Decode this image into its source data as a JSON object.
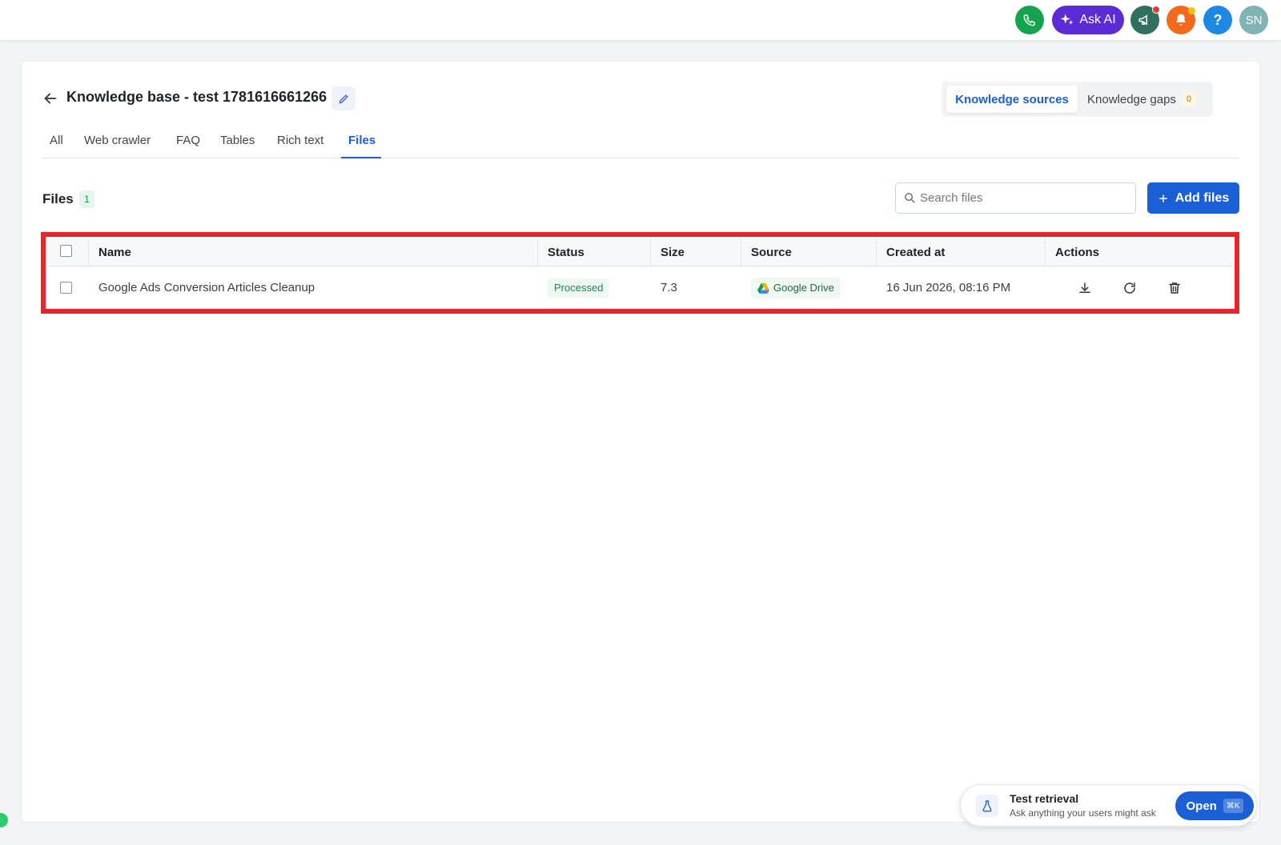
{
  "topbar": {
    "ask_ai_label": "Ask AI",
    "help_label": "?",
    "avatar_initials": "SN"
  },
  "header": {
    "title": "Knowledge base - test 1781616661266"
  },
  "switcher": {
    "sources_label": "Knowledge sources",
    "gaps_label": "Knowledge gaps",
    "gaps_count": "0"
  },
  "tabs": [
    {
      "label": "All"
    },
    {
      "label": "Web crawler"
    },
    {
      "label": "FAQ"
    },
    {
      "label": "Tables"
    },
    {
      "label": "Rich text"
    },
    {
      "label": "Files"
    }
  ],
  "active_tab": "Files",
  "files": {
    "title": "Files",
    "count": "1",
    "search_placeholder": "Search files",
    "add_button": "Add files"
  },
  "table": {
    "columns": [
      "Name",
      "Status",
      "Size",
      "Source",
      "Created at",
      "Actions"
    ],
    "rows": [
      {
        "name": "Google Ads Conversion Articles Cleanup",
        "status": "Processed",
        "size": "7.3",
        "source": "Google Drive",
        "created_at": "16 Jun 2026, 08:16 PM"
      }
    ]
  },
  "test_retrieval": {
    "title": "Test retrieval",
    "subtitle": "Ask anything your users might ask",
    "open_label": "Open",
    "shortcut": "⌘K"
  },
  "colors": {
    "accent": "#1a5fd6",
    "highlight_frame": "#e9242a",
    "ask_ai": "#5b2bd6"
  }
}
